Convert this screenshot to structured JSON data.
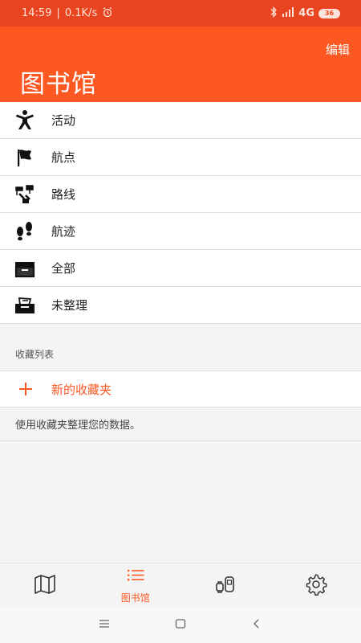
{
  "status_bar": {
    "time": "14:59",
    "separator": "|",
    "speed": "0.1K/s",
    "network": "4G",
    "battery": "36"
  },
  "header": {
    "edit_label": "编辑",
    "title": "图书馆"
  },
  "menu": {
    "items": [
      {
        "label": "活动",
        "icon": "activity-icon"
      },
      {
        "label": "航点",
        "icon": "flag-icon"
      },
      {
        "label": "路线",
        "icon": "route-icon"
      },
      {
        "label": "航迹",
        "icon": "footprints-icon"
      },
      {
        "label": "全部",
        "icon": "all-box-icon"
      },
      {
        "label": "未整理",
        "icon": "unsorted-box-icon"
      }
    ]
  },
  "collections": {
    "section_title": "收藏列表",
    "new_label": "新的收藏夹",
    "hint": "使用收藏夹整理您的数据。"
  },
  "bottom_nav": {
    "library_label": "图书馆"
  },
  "colors": {
    "accent": "#fd5722",
    "statusbar": "#e8441f"
  }
}
